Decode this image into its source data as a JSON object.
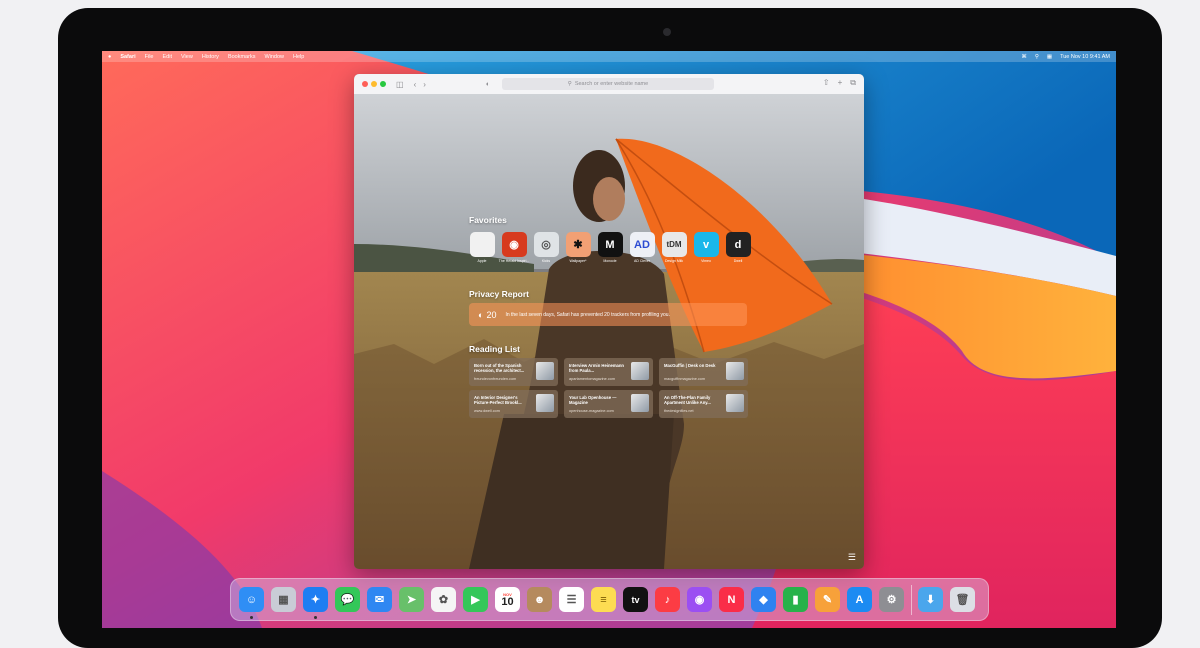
{
  "menubar": {
    "apple": "",
    "app": "Safari",
    "items": [
      "File",
      "Edit",
      "View",
      "History",
      "Bookmarks",
      "Window",
      "Help"
    ],
    "clock": "Tue Nov 10  9:41 AM"
  },
  "safari": {
    "url_placeholder": "Search or enter website name",
    "favorites_title": "Favorites",
    "favorites": [
      {
        "glyph": "",
        "label": "Apple",
        "color": "#f1f1f1",
        "fg": "#333333"
      },
      {
        "glyph": "◉",
        "label": "The Herald Inspiri...",
        "color": "#d73a1e",
        "fg": "#ffffff"
      },
      {
        "glyph": "◎",
        "label": "Kicks",
        "color": "#dfe3e6",
        "fg": "#555555"
      },
      {
        "glyph": "✱",
        "label": "Wallpaper*",
        "color": "#f2a074",
        "fg": "#111111"
      },
      {
        "glyph": "M",
        "label": "Monocle",
        "color": "#111111",
        "fg": "#ffffff"
      },
      {
        "glyph": "AD",
        "label": "AD Clever",
        "color": "#eef0f6",
        "fg": "#2d4bd2"
      },
      {
        "glyph": "tDM",
        "label": "Design Milk",
        "color": "#e8e8e8",
        "fg": "#333333"
      },
      {
        "glyph": "v",
        "label": "Vimeo",
        "color": "#1ab7ea",
        "fg": "#ffffff"
      },
      {
        "glyph": "d",
        "label": "Dwell",
        "color": "#222222",
        "fg": "#ffffff"
      }
    ],
    "privacy_title": "Privacy Report",
    "privacy_count": "20",
    "privacy_text": "In the last seven days, Safari has prevented 20 trackers from profiling you.",
    "reading_title": "Reading List",
    "reading": [
      {
        "title": "Born out of the Spanish recession, the architect...",
        "url": "freundevonfreunden.com"
      },
      {
        "title": "Interview Armin Heinemann from Paula...",
        "url": "apartamentomagazine.com"
      },
      {
        "title": "MacGuffin | Desk on Desk",
        "url": "macguffinmagazine.com"
      },
      {
        "title": "An Interior Designer's Picture-Perfect Brookl...",
        "url": "www.dwell.com"
      },
      {
        "title": "Your Lab Openhouse — Magazine",
        "url": "openhouse-magazine.com"
      },
      {
        "title": "An Off-The-Plan Family Apartment Unlike Any...",
        "url": "thedesignfiles.net"
      }
    ]
  },
  "dock": {
    "calendar_month": "NOV",
    "calendar_day": "10",
    "apps": [
      {
        "name": "finder-icon",
        "color": "#2f8ef5",
        "glyph": "☺"
      },
      {
        "name": "launchpad-icon",
        "color": "#c9ccd6",
        "glyph": "▦"
      },
      {
        "name": "safari-icon",
        "color": "#1e7ef2",
        "glyph": "✦"
      },
      {
        "name": "messages-icon",
        "color": "#33c759",
        "glyph": "💬"
      },
      {
        "name": "mail-icon",
        "color": "#2f87f2",
        "glyph": "✉"
      },
      {
        "name": "maps-icon",
        "color": "#68c06a",
        "glyph": "➤"
      },
      {
        "name": "photos-icon",
        "color": "#f5f5f5",
        "glyph": "✿"
      },
      {
        "name": "facetime-icon",
        "color": "#34c759",
        "glyph": "▶"
      },
      {
        "name": "calendar-icon",
        "color": "#ffffff",
        "glyph": ""
      },
      {
        "name": "contacts-icon",
        "color": "#b58a5e",
        "glyph": "☻"
      },
      {
        "name": "reminders-icon",
        "color": "#ffffff",
        "glyph": "☰"
      },
      {
        "name": "notes-icon",
        "color": "#fddc52",
        "glyph": "≡"
      },
      {
        "name": "tv-icon",
        "color": "#111111",
        "glyph": "tv"
      },
      {
        "name": "music-icon",
        "color": "#fc3c44",
        "glyph": "♪"
      },
      {
        "name": "podcasts-icon",
        "color": "#9b4ff2",
        "glyph": "◉"
      },
      {
        "name": "news-icon",
        "color": "#fa2d48",
        "glyph": "N"
      },
      {
        "name": "keynote-icon",
        "color": "#2f82f0",
        "glyph": "◆"
      },
      {
        "name": "numbers-icon",
        "color": "#27b24a",
        "glyph": "▮"
      },
      {
        "name": "pages-icon",
        "color": "#f7a13a",
        "glyph": "✎"
      },
      {
        "name": "app-store-icon",
        "color": "#1c8bf2",
        "glyph": "A"
      },
      {
        "name": "system-preferences-icon",
        "color": "#8e8e93",
        "glyph": "⚙"
      },
      {
        "name": "downloads-folder-icon",
        "color": "#4aa6ec",
        "glyph": "⬇"
      },
      {
        "name": "trash-icon",
        "color": "#dcdfe5",
        "glyph": "🗑"
      }
    ]
  }
}
